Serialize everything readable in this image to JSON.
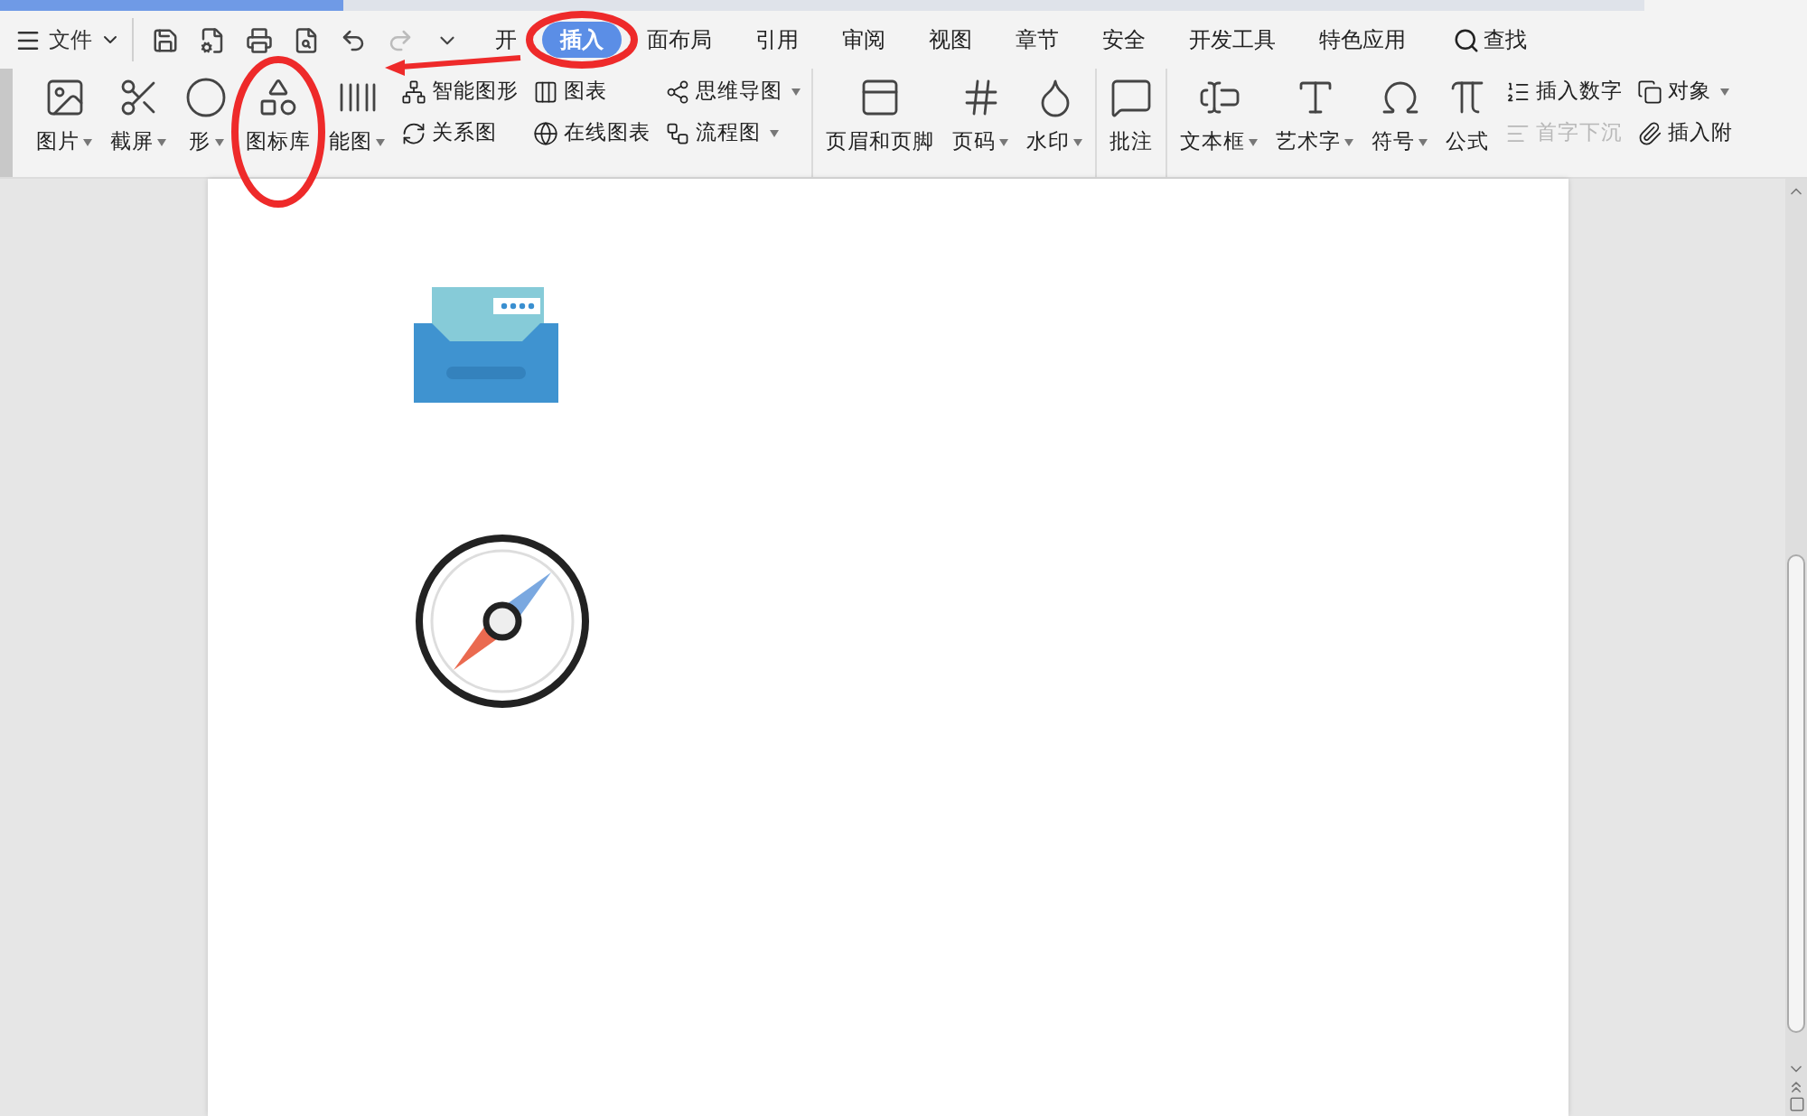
{
  "menu": {
    "file_label": "文件"
  },
  "tabs": [
    {
      "label": "开",
      "selected": false
    },
    {
      "label": "插入",
      "selected": true
    },
    {
      "label": "面布局",
      "selected": false
    },
    {
      "label": "引用",
      "selected": false
    },
    {
      "label": "审阅",
      "selected": false
    },
    {
      "label": "视图",
      "selected": false
    },
    {
      "label": "章节",
      "selected": false
    },
    {
      "label": "安全",
      "selected": false
    },
    {
      "label": "开发工具",
      "selected": false
    },
    {
      "label": "特色应用",
      "selected": false
    }
  ],
  "search": {
    "label": "查找"
  },
  "ribbon": {
    "groups": [
      {
        "items": [
          {
            "kind": "large",
            "label": "图片",
            "dropdown": true
          },
          {
            "kind": "large",
            "label": "截屏",
            "dropdown": true
          },
          {
            "kind": "large",
            "label": "形",
            "dropdown": true
          },
          {
            "kind": "large",
            "label": "图标库",
            "dropdown": false
          },
          {
            "kind": "large",
            "label": "能图",
            "dropdown": true
          },
          {
            "kind": "stack",
            "rows": [
              {
                "label": "智能图形",
                "dropdown": false,
                "disabled": false
              },
              {
                "label": "关系图",
                "dropdown": false,
                "disabled": false
              }
            ]
          },
          {
            "kind": "stack",
            "rows": [
              {
                "label": "图表",
                "dropdown": false,
                "disabled": false
              },
              {
                "label": "在线图表",
                "dropdown": false,
                "disabled": false
              }
            ]
          },
          {
            "kind": "stack",
            "rows": [
              {
                "label": "思维导图",
                "dropdown": true,
                "disabled": false
              },
              {
                "label": "流程图",
                "dropdown": true,
                "disabled": false
              }
            ]
          }
        ]
      },
      {
        "items": [
          {
            "kind": "large",
            "label": "页眉和页脚",
            "dropdown": false
          },
          {
            "kind": "large",
            "label": "页码",
            "dropdown": true
          },
          {
            "kind": "large",
            "label": "水印",
            "dropdown": true
          }
        ]
      },
      {
        "items": [
          {
            "kind": "large",
            "label": "批注",
            "dropdown": false
          }
        ]
      },
      {
        "items": [
          {
            "kind": "large",
            "label": "文本框",
            "dropdown": true
          },
          {
            "kind": "large",
            "label": "艺术字",
            "dropdown": true
          },
          {
            "kind": "large",
            "label": "符号",
            "dropdown": true
          },
          {
            "kind": "large",
            "label": "公式",
            "dropdown": false
          },
          {
            "kind": "stack",
            "rows": [
              {
                "label": "插入数字",
                "dropdown": false,
                "disabled": false
              },
              {
                "label": "首字下沉",
                "dropdown": false,
                "disabled": true
              }
            ]
          },
          {
            "kind": "stack",
            "rows": [
              {
                "label": "对象",
                "dropdown": true,
                "disabled": false
              },
              {
                "label": "插入附",
                "dropdown": false,
                "disabled": false
              }
            ]
          }
        ]
      }
    ]
  }
}
